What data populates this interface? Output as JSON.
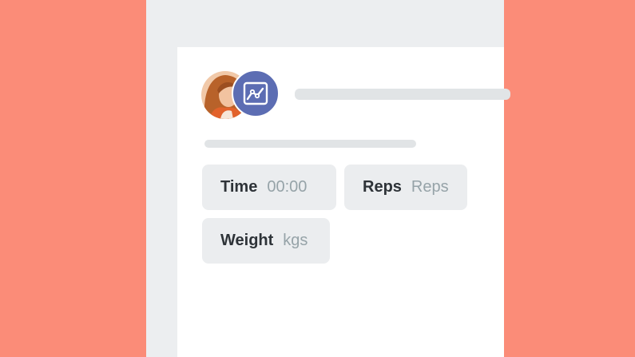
{
  "colors": {
    "background": "#FB8C78",
    "device": "#ECEEF0",
    "card": "#FFFFFF",
    "badge": "#5C6DB3",
    "field_bg": "#EBEDEF",
    "label": "#2E3338",
    "value": "#96A3A8"
  },
  "header": {
    "avatar_icon": "user-photo",
    "badge_icon": "line-chart-icon"
  },
  "fields": {
    "time": {
      "label": "Time",
      "value": "00:00"
    },
    "reps": {
      "label": "Reps",
      "value": "Reps"
    },
    "weight": {
      "label": "Weight",
      "value": "kgs"
    }
  }
}
